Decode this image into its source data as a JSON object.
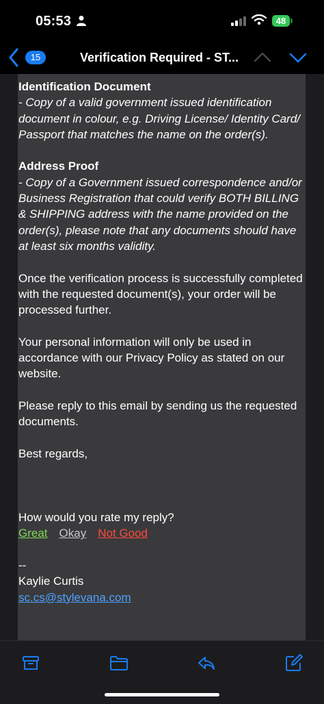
{
  "status_bar": {
    "time": "05:53",
    "battery": "48"
  },
  "nav": {
    "back_count": "15",
    "title": "Verification Required - ST..."
  },
  "email": {
    "id_heading": "Identification Document",
    "id_text": "- Copy of a valid government issued identification document in colour, e.g. Driving License/ Identity Card/ Passport that matches the name on the order(s).",
    "address_heading": "Address Proof",
    "address_text": "- Copy of a Government issued correspondence and/or Business Registration that could verify BOTH BILLING & SHIPPING address with the name provided on the order(s), please note that any documents should have at least six months validity.",
    "para_process": "Once the verification process is successfully completed with the requested document(s), your order will be processed further.",
    "para_privacy": "Your personal information will only be used in accordance with our Privacy Policy as stated on our website.",
    "para_reply": "Please reply to this email by sending us the requested documents.",
    "closing": "Best regards,",
    "rate_question": "How would you rate my reply?",
    "rating": {
      "great": "Great",
      "okay": "Okay",
      "not_good": "Not Good"
    },
    "sig_separator": "--",
    "sig_name": "Kaylie Curtis",
    "sig_email": "sc.cs@stylevana.com"
  },
  "colors": {
    "accent": "#1a7cf0",
    "great": "#7ed957",
    "not_good": "#ff4a3d",
    "card": "#3a3a3c"
  },
  "toolbar": {
    "icons": [
      "archive-icon",
      "folder-icon",
      "reply-icon",
      "compose-icon"
    ]
  }
}
